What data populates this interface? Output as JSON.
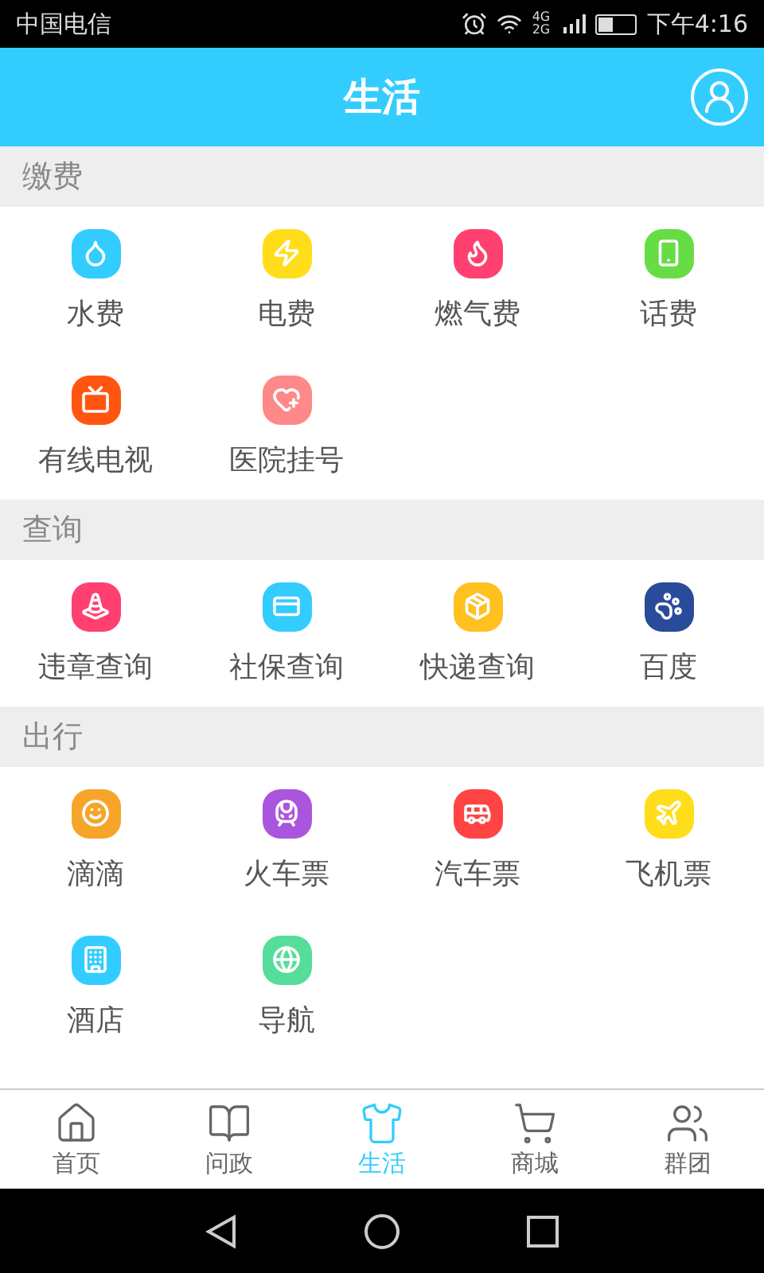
{
  "status_bar": {
    "carrier": "中国电信",
    "network": "4G 2G",
    "time": "下午4:16"
  },
  "header": {
    "title": "生活"
  },
  "sections": [
    {
      "title": "缴费",
      "items": [
        {
          "label": "水费",
          "color": "#33ccff"
        },
        {
          "label": "电费",
          "color": "#ffdd1a"
        },
        {
          "label": "燃气费",
          "color": "#ff4070"
        },
        {
          "label": "话费",
          "color": "#66dd44"
        },
        {
          "label": "有线电视",
          "color": "#ff5511"
        },
        {
          "label": "医院挂号",
          "color": "#ff8888"
        }
      ]
    },
    {
      "title": "查询",
      "items": [
        {
          "label": "违章查询",
          "color": "#ff4070"
        },
        {
          "label": "社保查询",
          "color": "#33ccff"
        },
        {
          "label": "快递查询",
          "color": "#ffc020"
        },
        {
          "label": "百度",
          "color": "#2a4a9a"
        }
      ]
    },
    {
      "title": "出行",
      "items": [
        {
          "label": "滴滴",
          "color": "#f7a52a"
        },
        {
          "label": "火车票",
          "color": "#aa55dd"
        },
        {
          "label": "汽车票",
          "color": "#ff4444"
        },
        {
          "label": "飞机票",
          "color": "#ffdd1a"
        },
        {
          "label": "酒店",
          "color": "#33ccff"
        },
        {
          "label": "导航",
          "color": "#55dd99"
        }
      ]
    }
  ],
  "tabs": [
    {
      "label": "首页",
      "selected": false
    },
    {
      "label": "问政",
      "selected": false
    },
    {
      "label": "生活",
      "selected": true
    },
    {
      "label": "商城",
      "selected": false
    },
    {
      "label": "群团",
      "selected": false
    }
  ]
}
